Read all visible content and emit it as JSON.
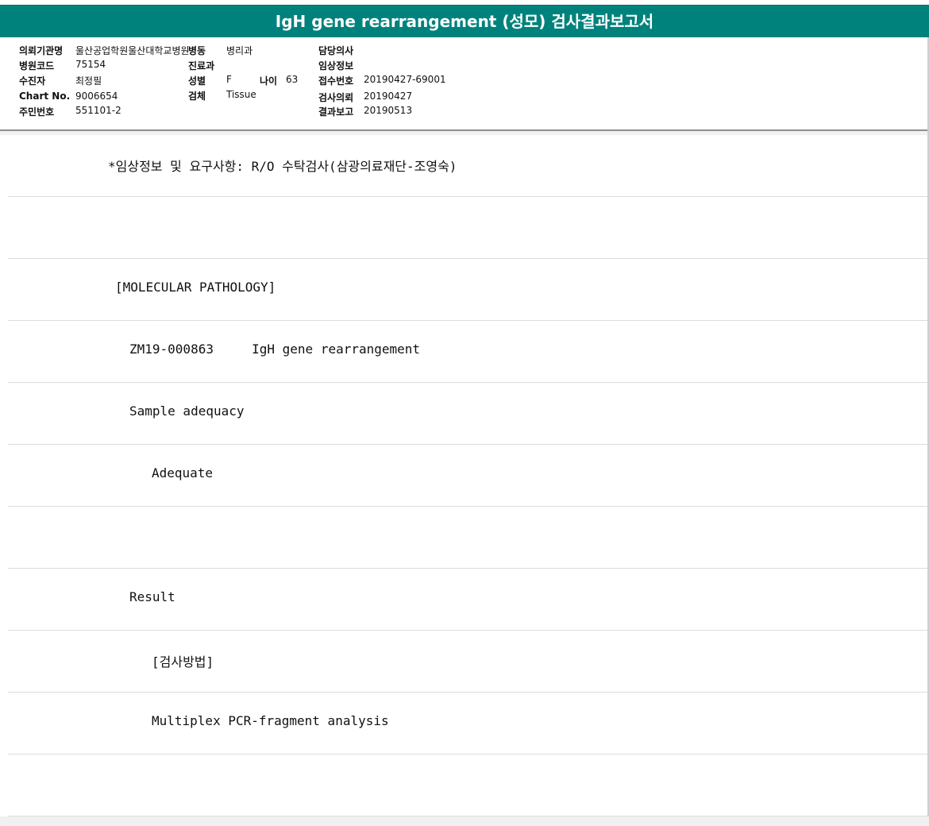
{
  "header": {
    "title": "IgH gene rearrangement (성모) 검사결과보고서"
  },
  "info": {
    "institution_label": "의뢰기관명",
    "institution_value": "울산공업학원울산대학교병원",
    "ward_label": "병동",
    "ward_value": "병리과",
    "doctor_label": "담당의사",
    "doctor_value": "",
    "hospital_code_label": "병원코드",
    "hospital_code_value": "75154",
    "department_label": "진료과",
    "department_value": "",
    "clinical_info_label": "임상정보",
    "clinical_info_value": "",
    "patient_label": "수진자",
    "patient_value": "최정필",
    "sex_label": "성별",
    "sex_value": "F",
    "age_label": "나이",
    "age_value": "63",
    "accession_label": "접수번호",
    "accession_value": "20190427-69001",
    "chart_label": "Chart No.",
    "chart_value": "9006654",
    "specimen_label": "검체",
    "specimen_value": "Tissue",
    "request_label": "검사의뢰",
    "request_value": "20190427",
    "resident_label": "주민번호",
    "resident_value": "551101-2",
    "report_label": "결과보고",
    "report_value": "20190513"
  },
  "report_lines": [
    "*임상정보 및 요구사항: R/O 수탁검사(삼광의료재단-조영숙)",
    "",
    "[MOLECULAR PATHOLOGY]",
    "ZM19-000863     IgH gene rearrangement",
    "Sample adequacy",
    "Adequate",
    "",
    "Result",
    "[검사방법]",
    "Multiplex PCR-fragment analysis",
    ""
  ],
  "colors": {
    "header_bg": "#00827c",
    "divider": "#dcdcdc"
  }
}
